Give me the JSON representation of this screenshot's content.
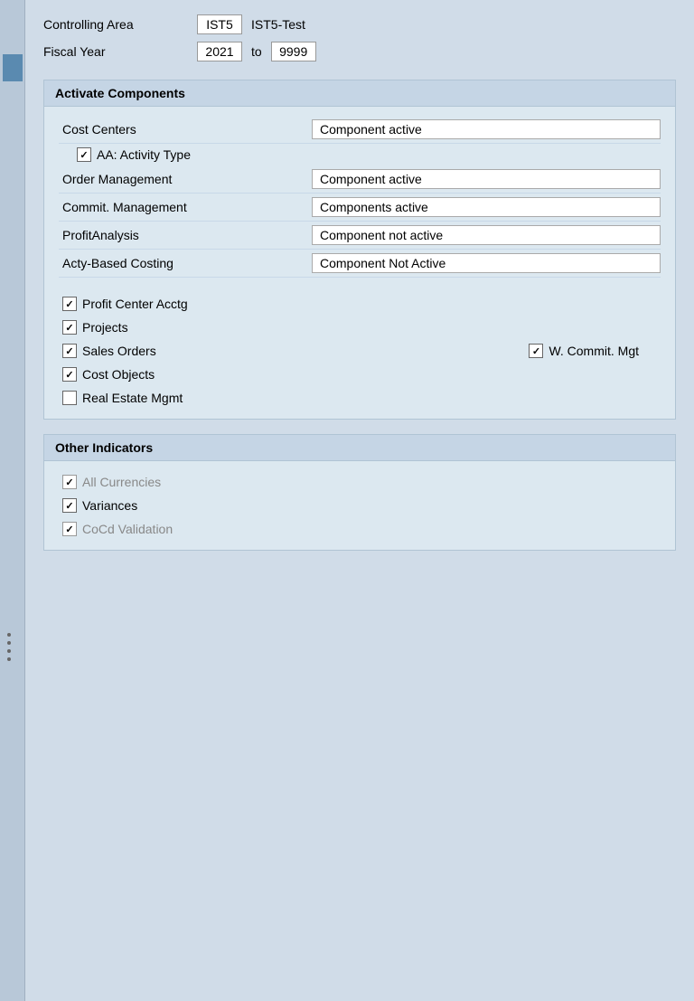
{
  "controlling_area": {
    "label": "Controlling Area",
    "code": "IST5",
    "name": "IST5-Test"
  },
  "fiscal_year": {
    "label": "Fiscal Year",
    "from": "2021",
    "to_label": "to",
    "to": "9999"
  },
  "activate_components": {
    "section_title": "Activate Components",
    "rows": [
      {
        "label": "Cost Centers",
        "status": "Component active"
      },
      {
        "label": "Order Management",
        "status": "Component active"
      },
      {
        "label": "Commit. Management",
        "status": "Components active"
      },
      {
        "label": "ProfitAnalysis",
        "status": "Component not active"
      },
      {
        "label": "Acty-Based Costing",
        "status": "Component Not Active"
      }
    ],
    "sub_checkbox": {
      "checked": true,
      "label": "AA: Activity Type"
    },
    "checkboxes": [
      {
        "label": "Profit Center Acctg",
        "checked": true
      },
      {
        "label": "Projects",
        "checked": true
      },
      {
        "label": "Sales Orders",
        "checked": true
      },
      {
        "label": "Cost Objects",
        "checked": true
      },
      {
        "label": "Real Estate Mgmt",
        "checked": false
      }
    ],
    "right_checkbox": {
      "label": "W. Commit. Mgt",
      "checked": true
    }
  },
  "other_indicators": {
    "section_title": "Other Indicators",
    "checkboxes": [
      {
        "label": "All Currencies",
        "checked": true,
        "disabled": true
      },
      {
        "label": "Variances",
        "checked": true,
        "disabled": false
      },
      {
        "label": "CoCd Validation",
        "checked": true,
        "disabled": true
      }
    ]
  }
}
